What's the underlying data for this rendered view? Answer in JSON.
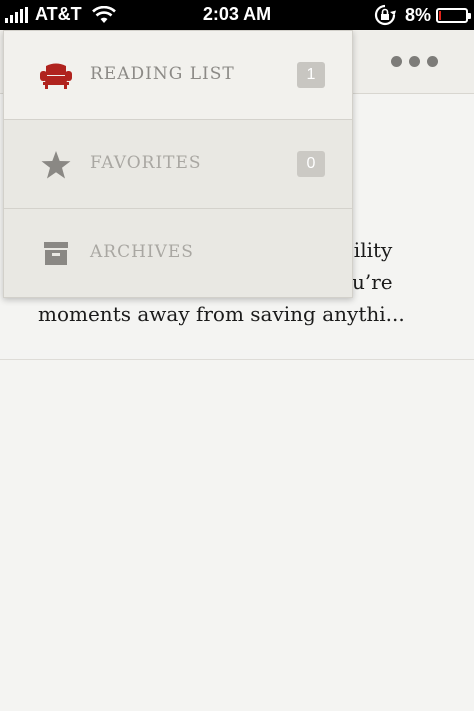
{
  "status_bar": {
    "carrier": "AT&T",
    "time": "2:03 AM",
    "battery": "8%",
    "battery_level": 0.08
  },
  "header": {
    "more_icon": "ellipsis-icon"
  },
  "content": {
    "excerpt_line1": "bility",
    "excerpt_line2": "u’re",
    "excerpt_line3": "moments away from saving anythi..."
  },
  "menu": {
    "items": [
      {
        "label": "READING LIST",
        "count": "1",
        "icon": "armchair-icon",
        "icon_color": "#b0231e",
        "selected": true
      },
      {
        "label": "FAVORITES",
        "count": "0",
        "icon": "star-icon",
        "icon_color": "#8a8884",
        "selected": false
      },
      {
        "label": "ARCHIVES",
        "icon": "archive-box-icon",
        "icon_color": "#8a8884",
        "selected": false
      }
    ]
  },
  "colors": {
    "accent": "#b0231e",
    "background": "#f4f4f2",
    "menu_background": "#e9e8e3"
  }
}
